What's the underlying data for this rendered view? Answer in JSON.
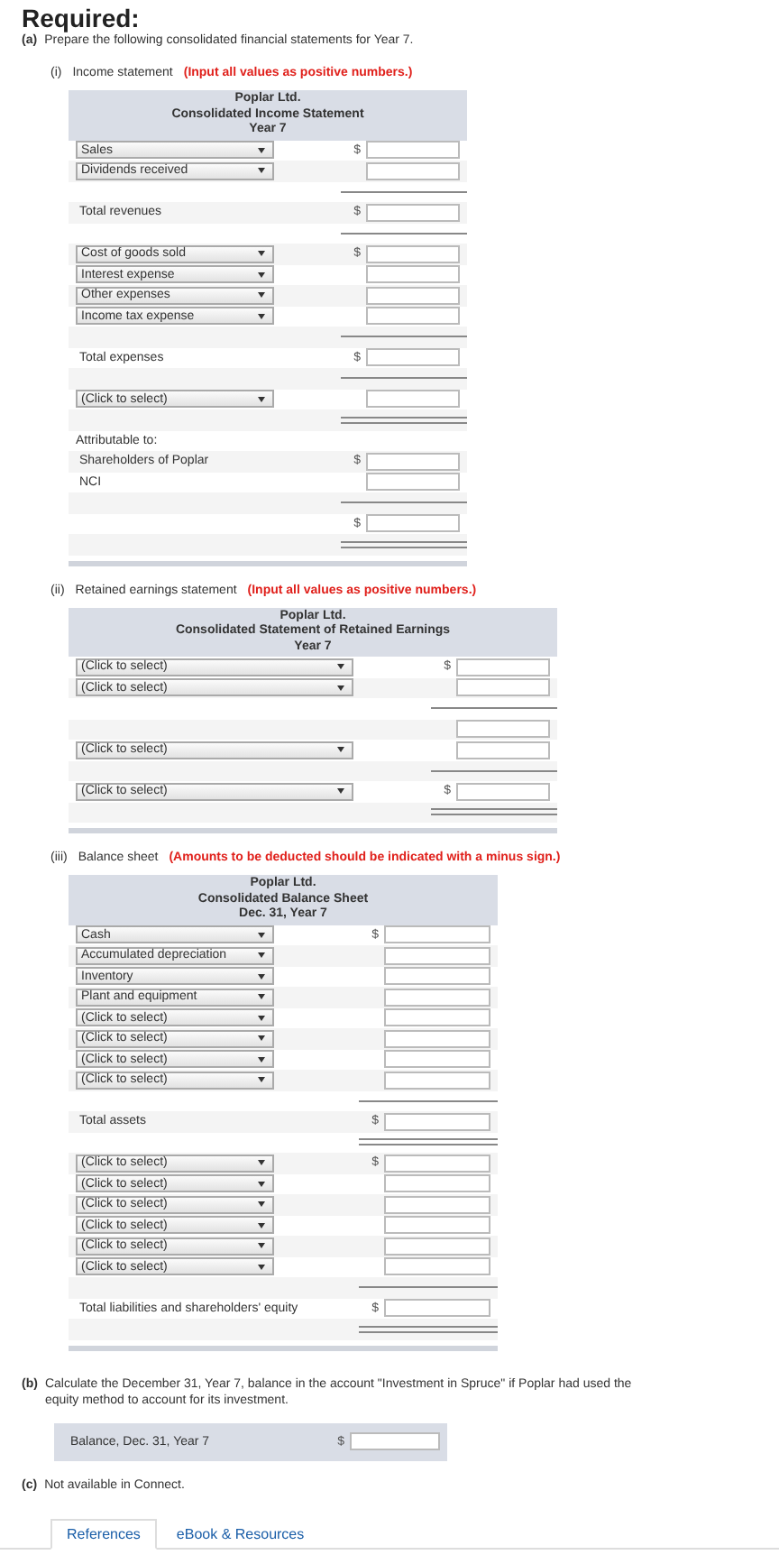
{
  "heading": "Required:",
  "part_a": {
    "marker": "(a)",
    "text": "Prepare the following consolidated financial statements for Year 7."
  },
  "sections": [
    {
      "marker": "(i)",
      "label": "Income statement",
      "note": "(Input all values as positive numbers.)",
      "title_lines": [
        "Poplar Ltd.",
        "Consolidated Income Statement",
        "Year 7"
      ],
      "rows": [
        {
          "kind": "select",
          "value": "Sales",
          "dollar": "$"
        },
        {
          "kind": "select",
          "value": "Dividends received"
        },
        {
          "kind": "rule"
        },
        {
          "kind": "text",
          "label": "Total revenues",
          "dollar": "$"
        },
        {
          "kind": "rule"
        },
        {
          "kind": "select",
          "value": "Cost of goods sold",
          "dollar": "$"
        },
        {
          "kind": "select",
          "value": "Interest expense"
        },
        {
          "kind": "select",
          "value": "Other expenses"
        },
        {
          "kind": "select",
          "value": "Income tax expense"
        },
        {
          "kind": "rule"
        },
        {
          "kind": "text",
          "label": "Total expenses",
          "dollar": "$"
        },
        {
          "kind": "rule"
        },
        {
          "kind": "select",
          "value": "(Click to select)"
        },
        {
          "kind": "double_rule"
        },
        {
          "kind": "caption",
          "label": "Attributable to:"
        },
        {
          "kind": "text",
          "label": "Shareholders of Poplar",
          "dollar": "$"
        },
        {
          "kind": "text",
          "label": "NCI"
        },
        {
          "kind": "rule"
        },
        {
          "kind": "input",
          "dollar": "$"
        },
        {
          "kind": "double_rule"
        }
      ]
    },
    {
      "marker": "(ii)",
      "label": "Retained earnings statement",
      "note": "(Input all values as positive numbers.)",
      "title_lines": [
        "Poplar Ltd.",
        "Consolidated Statement of Retained Earnings",
        "Year 7"
      ],
      "rows": [
        {
          "kind": "select",
          "value": "(Click to select)",
          "dollar": "$"
        },
        {
          "kind": "select",
          "value": "(Click to select)"
        },
        {
          "kind": "rule"
        },
        {
          "kind": "input"
        },
        {
          "kind": "select",
          "value": "(Click to select)"
        },
        {
          "kind": "rule"
        },
        {
          "kind": "select",
          "value": "(Click to select)",
          "dollar": "$"
        },
        {
          "kind": "double_rule"
        }
      ]
    },
    {
      "marker": "(iii)",
      "label": "Balance sheet",
      "note": "(Amounts to be deducted should be indicated with a minus sign.)",
      "title_lines": [
        "Poplar Ltd.",
        "Consolidated Balance Sheet",
        "Dec. 31, Year 7"
      ],
      "rows": [
        {
          "kind": "select",
          "value": "Cash",
          "dollar": "$"
        },
        {
          "kind": "select",
          "value": "Accumulated depreciation"
        },
        {
          "kind": "select",
          "value": "Inventory"
        },
        {
          "kind": "select",
          "value": "Plant and equipment"
        },
        {
          "kind": "select",
          "value": "(Click to select)"
        },
        {
          "kind": "select",
          "value": "(Click to select)"
        },
        {
          "kind": "select",
          "value": "(Click to select)"
        },
        {
          "kind": "select",
          "value": "(Click to select)"
        },
        {
          "kind": "rule"
        },
        {
          "kind": "text",
          "label": "Total assets",
          "dollar": "$"
        },
        {
          "kind": "double_rule"
        },
        {
          "kind": "select",
          "value": "(Click to select)",
          "dollar": "$"
        },
        {
          "kind": "select",
          "value": "(Click to select)"
        },
        {
          "kind": "select",
          "value": "(Click to select)"
        },
        {
          "kind": "select",
          "value": "(Click to select)"
        },
        {
          "kind": "select",
          "value": "(Click to select)"
        },
        {
          "kind": "select",
          "value": "(Click to select)"
        },
        {
          "kind": "rule"
        },
        {
          "kind": "text",
          "label": "Total liabilities and shareholders' equity",
          "dollar": "$"
        },
        {
          "kind": "double_rule"
        }
      ]
    }
  ],
  "part_b": {
    "marker": "(b)",
    "text": "Calculate the December 31, Year 7, balance in the account \"Investment in Spruce\" if Poplar had used the equity method to account for its investment.",
    "row_label": "Balance, Dec. 31, Year 7",
    "dollar": "$"
  },
  "part_c": {
    "marker": "(c)",
    "text": "Not available in Connect."
  },
  "tabs": [
    {
      "label": "References",
      "selected": true
    },
    {
      "label": "eBook & Resources",
      "selected": false
    }
  ]
}
